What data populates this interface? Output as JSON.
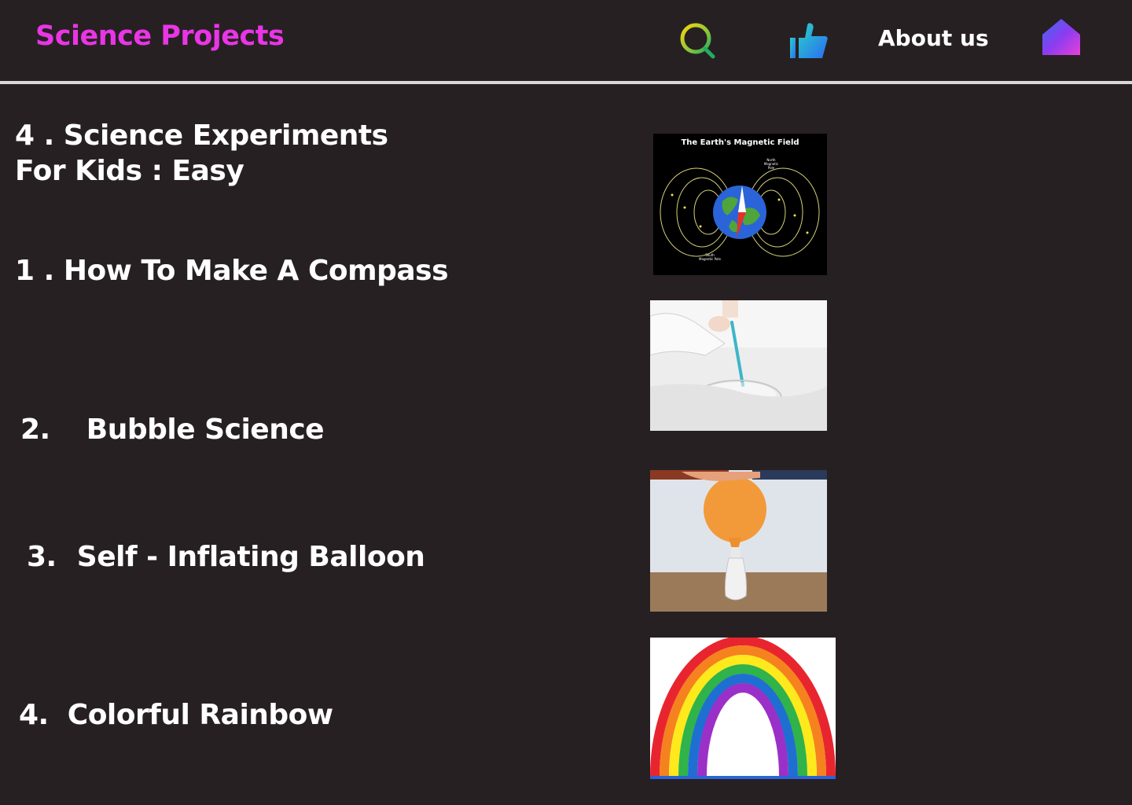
{
  "header": {
    "brand": "Science Projects",
    "about_label": "About us",
    "icons": {
      "search": "search-icon",
      "like": "thumbs-up-icon",
      "home": "home-icon"
    }
  },
  "main": {
    "heading_line1": "4 . Science Experiments",
    "heading_line2": "For Kids : Easy",
    "items": [
      {
        "number": "1 .",
        "label": "How To Make A Compass"
      },
      {
        "number": "2.",
        "label": "Bubble Science"
      },
      {
        "number": "3.",
        "label": "Self - Inflating Balloon"
      },
      {
        "number": "4.",
        "label": "Colorful  Rainbow"
      }
    ],
    "compass_image": {
      "title": "The Earth's Magnetic Field",
      "north_label": "North Magnetic Pole",
      "south_label": "South Magnetic Pole"
    }
  },
  "colors": {
    "background": "#272022",
    "brand": "#e935e6",
    "divider": "#d9d9d9",
    "text": "#ffffff"
  }
}
